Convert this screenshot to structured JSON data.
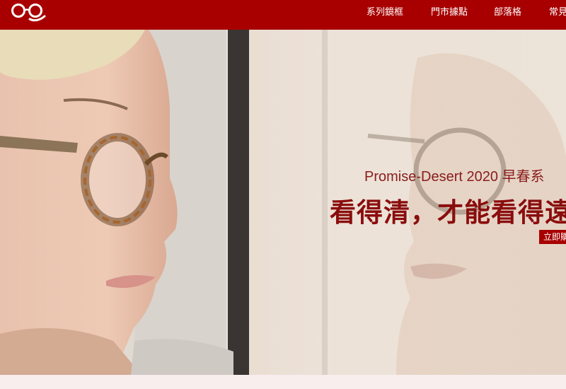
{
  "navbar": {
    "logo_icon": "eyeglasses-smile-icon",
    "items": [
      {
        "label": "系列鏡框"
      },
      {
        "label": "門市據點"
      },
      {
        "label": "部落格"
      },
      {
        "label": "常見"
      }
    ]
  },
  "hero": {
    "subtitle": "Promise-Desert 2020 早春系",
    "headline": "看得清，才能看得遠",
    "cta_label": "立即購"
  },
  "colors": {
    "brand": "#a80000",
    "headline": "#8a0d0d"
  }
}
